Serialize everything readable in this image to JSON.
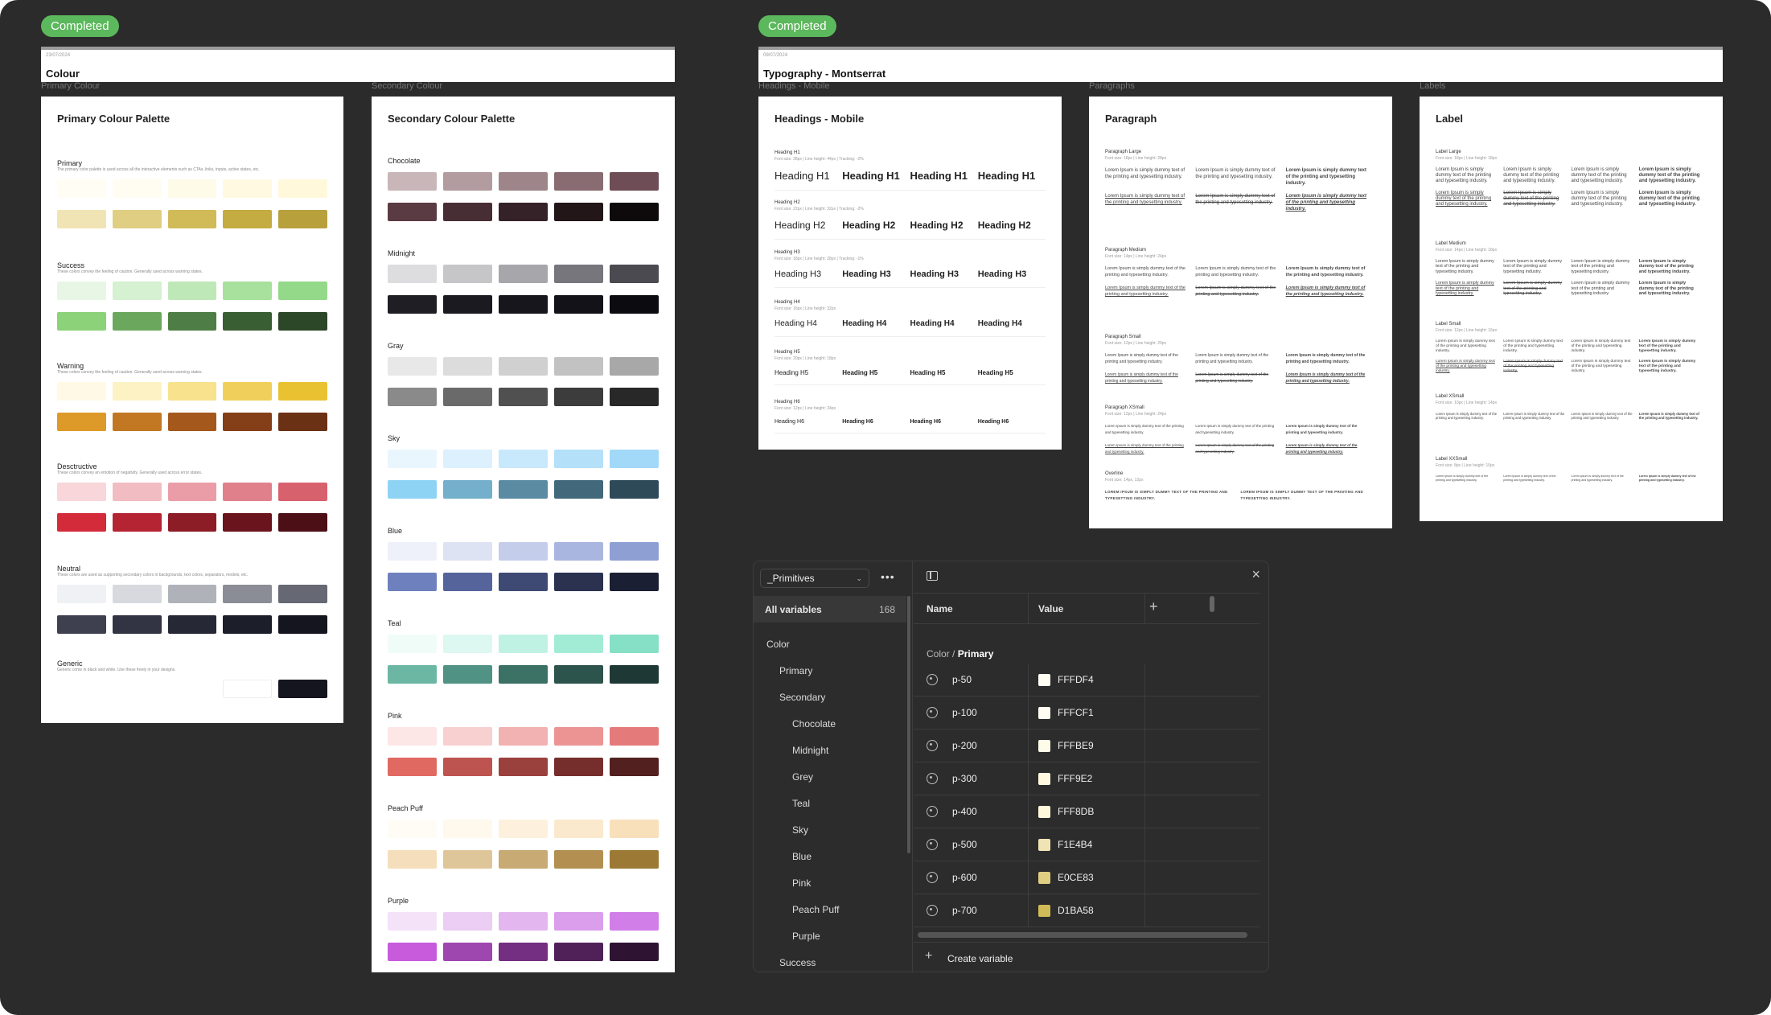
{
  "left_section": {
    "badge": "Completed",
    "date": "23/07/2024",
    "title": "Colour",
    "frames": [
      {
        "label": "Primary Colour",
        "title": "Primary Colour Palette"
      },
      {
        "label": "Secondary Colour",
        "title": "Secondary Colour Palette"
      }
    ]
  },
  "primary_palette": [
    {
      "name": "Primary",
      "desc": "The primary color palette is used across all the interactive elements such as CTAs, links, inputs, active states, etc.",
      "colors": [
        "#FFFDF4",
        "#FFFCF1",
        "#FFFBE9",
        "#FFF9E2",
        "#FFF8DB",
        "#F1E4B4",
        "#E0CE83",
        "#D1BA58",
        "#C4AB42",
        "#B8A03C"
      ]
    },
    {
      "name": "Success",
      "desc": "These colors convey the feeling of caution. Generally used across warning states.",
      "colors": [
        "#E8F6E6",
        "#D6F0D2",
        "#BFE8B8",
        "#A8E09E",
        "#94D98A",
        "#8BD278",
        "#6BA85E",
        "#4E7E45",
        "#3A5E34",
        "#2C4727"
      ]
    },
    {
      "name": "Warning",
      "desc": "These colors convey the feeling of caution. Generally used across warning states.",
      "colors": [
        "#FFF9E6",
        "#FDF2C4",
        "#F8E28E",
        "#F0D05A",
        "#E9C232",
        "#DD9A28",
        "#C27822",
        "#A4581C",
        "#843F18",
        "#6A3114"
      ]
    },
    {
      "name": "Desctructive",
      "desc": "These colors convey an emotion of negativity. Generally used across error states.",
      "colors": [
        "#F8D6DA",
        "#F1BCC2",
        "#EA9DA6",
        "#E0808B",
        "#D8616E",
        "#D42B3A",
        "#B52432",
        "#8C1C26",
        "#6A151D",
        "#4C0F15"
      ]
    },
    {
      "name": "Neutral",
      "desc": "These colors are used as supporting secondary colors in backgrounds, text colors, separators, models, etc.",
      "colors": [
        "#F0F1F4",
        "#D8D9DE",
        "#B0B2BA",
        "#8A8C96",
        "#666874",
        "#3E4050",
        "#323444",
        "#262836",
        "#1C1E2A",
        "#14151E"
      ]
    },
    {
      "name": "Generic",
      "desc": "Generic come in black and white. Use these freely in your designs.",
      "colors": [
        "#FFFFFF",
        "#14151E"
      ]
    }
  ],
  "secondary_palette": [
    {
      "name": "Chocolate",
      "colors": [
        "#C9B6B8",
        "#B29C9F",
        "#9E8589",
        "#886C71",
        "#6E4D56",
        "#5A3B43",
        "#472E35",
        "#352228",
        "#221619",
        "#0E0A0B"
      ]
    },
    {
      "name": "Midnight",
      "colors": [
        "#DDDDDF",
        "#C6C6C9",
        "#A6A6AB",
        "#76767C",
        "#4A4A50",
        "#1E1E24",
        "#1A1A20",
        "#16161C",
        "#121218",
        "#0C0C10"
      ]
    },
    {
      "name": "Gray",
      "colors": [
        "#E8E8E8",
        "#DCDCDC",
        "#D0D0D0",
        "#C2C2C2",
        "#A8A8A8",
        "#8A8A8A",
        "#6A6A6A",
        "#505050",
        "#3C3C3C",
        "#282828"
      ]
    },
    {
      "name": "Sky",
      "colors": [
        "#EAF6FE",
        "#DCF0FE",
        "#C8E8FC",
        "#B4E0FA",
        "#A2D8F8",
        "#8FD3F4",
        "#74AFCB",
        "#5A8BA3",
        "#42687C",
        "#2E4A59"
      ]
    },
    {
      "name": "Blue",
      "colors": [
        "#EEF1FA",
        "#DEE3F4",
        "#C4CDEA",
        "#A9B6DF",
        "#8E9FD4",
        "#6E80BD",
        "#55649A",
        "#3E4A74",
        "#2A3250",
        "#1A1F33"
      ]
    },
    {
      "name": "Teal",
      "colors": [
        "#F0FCF8",
        "#DDF8F0",
        "#BFF2E3",
        "#A2ECD6",
        "#86E0C6",
        "#6BB7A3",
        "#509283",
        "#3C7166",
        "#2C534C",
        "#1E3935"
      ]
    },
    {
      "name": "Pink",
      "colors": [
        "#FCE6E6",
        "#F8D0D0",
        "#F2B2B2",
        "#EC9494",
        "#E57A7A",
        "#E06A62",
        "#BE5450",
        "#9A403D",
        "#762E2C",
        "#52201F"
      ]
    },
    {
      "name": "Peach Puff",
      "colors": [
        "#FFFCF6",
        "#FFF8EC",
        "#FDF1DD",
        "#FBE9CD",
        "#F8E0BB",
        "#F5DEBB",
        "#DFC69A",
        "#C8AA74",
        "#B39052",
        "#9C7A36"
      ]
    },
    {
      "name": "Purple",
      "colors": [
        "#F4E2F8",
        "#ECCDF4",
        "#E3B6F0",
        "#DA9EEC",
        "#D17EE8",
        "#C75BDC",
        "#9E47AF",
        "#742F82",
        "#502158",
        "#2E1333"
      ]
    }
  ],
  "right_section": {
    "badge": "Completed",
    "date": "09/07/2024",
    "title": "Typography - Montserrat",
    "frames": [
      {
        "label": "Headings - Mobile",
        "title": "Headings - Mobile"
      },
      {
        "label": "Paragraphs",
        "title": "Paragraph"
      },
      {
        "label": "Labels",
        "title": "Label"
      }
    ]
  },
  "headings": [
    {
      "name": "Heading H1",
      "meta": "Font size: 28px | Line height: 44px | Tracking: -2%",
      "sample": "Heading H1"
    },
    {
      "name": "Heading H2",
      "meta": "Font size: 22px | Line height: 32px | Tracking: -2%",
      "sample": "Heading H2"
    },
    {
      "name": "Heading H3",
      "meta": "Font size: 18px | Line height: 28px | Tracking: -1%",
      "sample": "Heading H3"
    },
    {
      "name": "Heading H4",
      "meta": "Font size: 16px | Line height: 32px",
      "sample": "Heading H4"
    },
    {
      "name": "Heading H5",
      "meta": "Font size: 20px | Line height: 18px",
      "sample": "Heading H5"
    },
    {
      "name": "Heading H6",
      "meta": "Font size: 12px | Line height: 24px",
      "sample": "Heading H6"
    }
  ],
  "paragraphs": [
    {
      "name": "Paragraph Large",
      "meta": "Font size: 18px | Line height: 28px"
    },
    {
      "name": "Paragraph Medium",
      "meta": "Font size: 14px | Line height: 24px"
    },
    {
      "name": "Paragraph Small",
      "meta": "Font size: 12px | Line height: 20px"
    },
    {
      "name": "Paragraph XSmall",
      "meta": "Font size: 12px | Line height: 24px"
    },
    {
      "name": "Overline",
      "meta": "Font size: 14px, 12px"
    }
  ],
  "lorem": "Lorem Ipsum is simply dummy text of the printing and typesetting industry.",
  "overline_text": "LOREM IPSUM IS SIMPLY DUMMY TEXT OF THE PRINTING AND TYPESETTING INDUSTRY.",
  "labels": [
    {
      "name": "Label Large",
      "meta": "Font size: 18px | Line height: 18px"
    },
    {
      "name": "Label Medium",
      "meta": "Font size: 14px | Line height: 18px"
    },
    {
      "name": "Label Small",
      "meta": "Font size: 12px | Line height: 16px"
    },
    {
      "name": "Label XSmall",
      "meta": "Font size: 10px | Line height: 14px"
    },
    {
      "name": "Label XXSmall",
      "meta": "Font size: 8px | Line height: 10px"
    }
  ],
  "variables_panel": {
    "collection": "_Primitives",
    "all_variables_label": "All variables",
    "all_variables_count": "168",
    "tree": [
      {
        "label": "Color",
        "level": 0
      },
      {
        "label": "Primary",
        "level": 1
      },
      {
        "label": "Secondary",
        "level": 1
      },
      {
        "label": "Chocolate",
        "level": 2
      },
      {
        "label": "Midnight",
        "level": 2
      },
      {
        "label": "Grey",
        "level": 2
      },
      {
        "label": "Teal",
        "level": 2
      },
      {
        "label": "Sky",
        "level": 2
      },
      {
        "label": "Blue",
        "level": 2
      },
      {
        "label": "Pink",
        "level": 2
      },
      {
        "label": "Peach Puff",
        "level": 2
      },
      {
        "label": "Purple",
        "level": 2
      },
      {
        "label": "Success",
        "level": 1
      }
    ],
    "col_name": "Name",
    "col_value": "Value",
    "group_path": "Color",
    "group_sep": " / ",
    "group_name": "Primary",
    "rows": [
      {
        "name": "p-50",
        "value": "FFFDF4",
        "color": "#FFFDF4"
      },
      {
        "name": "p-100",
        "value": "FFFCF1",
        "color": "#FFFCF1"
      },
      {
        "name": "p-200",
        "value": "FFFBE9",
        "color": "#FFFBE9"
      },
      {
        "name": "p-300",
        "value": "FFF9E2",
        "color": "#FFF9E2"
      },
      {
        "name": "p-400",
        "value": "FFF8DB",
        "color": "#FFF8DB"
      },
      {
        "name": "p-500",
        "value": "F1E4B4",
        "color": "#F1E4B4"
      },
      {
        "name": "p-600",
        "value": "E0CE83",
        "color": "#E0CE83"
      },
      {
        "name": "p-700",
        "value": "D1BA58",
        "color": "#D1BA58"
      }
    ],
    "create_label": "Create variable"
  }
}
